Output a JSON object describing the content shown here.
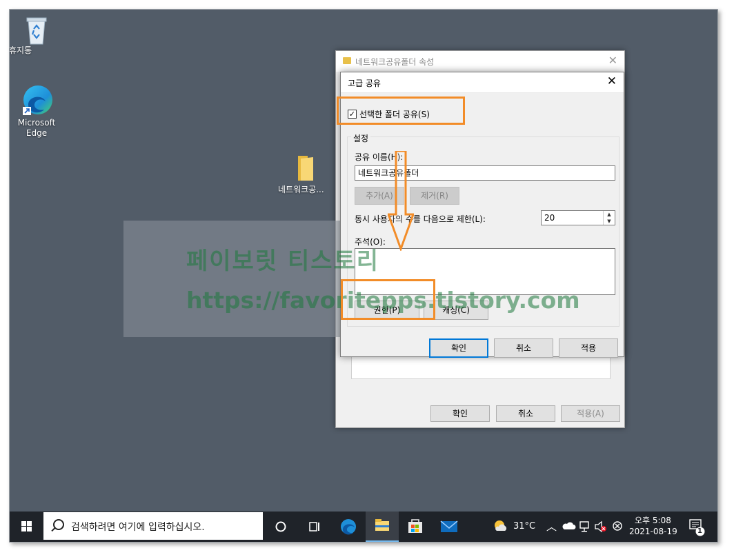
{
  "desktop": {
    "icons": [
      {
        "label": "휴지통"
      },
      {
        "label": "Microsoft Edge"
      },
      {
        "label": "네트워크공..."
      }
    ]
  },
  "watermark": {
    "line1": "페이보릿 티스토리",
    "line2": "https://favoritepps.tistory.com"
  },
  "back_dialog": {
    "title": "네트워크공유폴더 속성",
    "ok": "확인",
    "cancel": "취소",
    "apply": "적용(A)"
  },
  "advanced_sharing": {
    "title": "고급 공유",
    "share_checkbox": "선택한 폴더 공유(S)",
    "share_checked": true,
    "settings_group": "설정",
    "share_name_label": "공유 이름(H):",
    "share_name_value": "네트워크공유폴더",
    "add_button": "추가(A)",
    "remove_button": "제거(R)",
    "user_limit_label": "동시 사용자의 수를 다음으로 제한(L):",
    "user_limit_value": "20",
    "comment_label": "주석(O):",
    "comment_value": "",
    "permissions_button": "권한(P)",
    "caching_button": "캐싱(C)",
    "ok": "확인",
    "cancel": "취소",
    "apply": "적용"
  },
  "taskbar": {
    "search_placeholder": "검색하려면 여기에 입력하십시오.",
    "weather": "31°C",
    "time": "오후 5:08",
    "date": "2021-08-19",
    "notification_count": "1"
  },
  "colors": {
    "highlight": "#f28c28",
    "desktop": "#525c68",
    "taskbar": "#1f2329",
    "accent": "#0078d7"
  }
}
